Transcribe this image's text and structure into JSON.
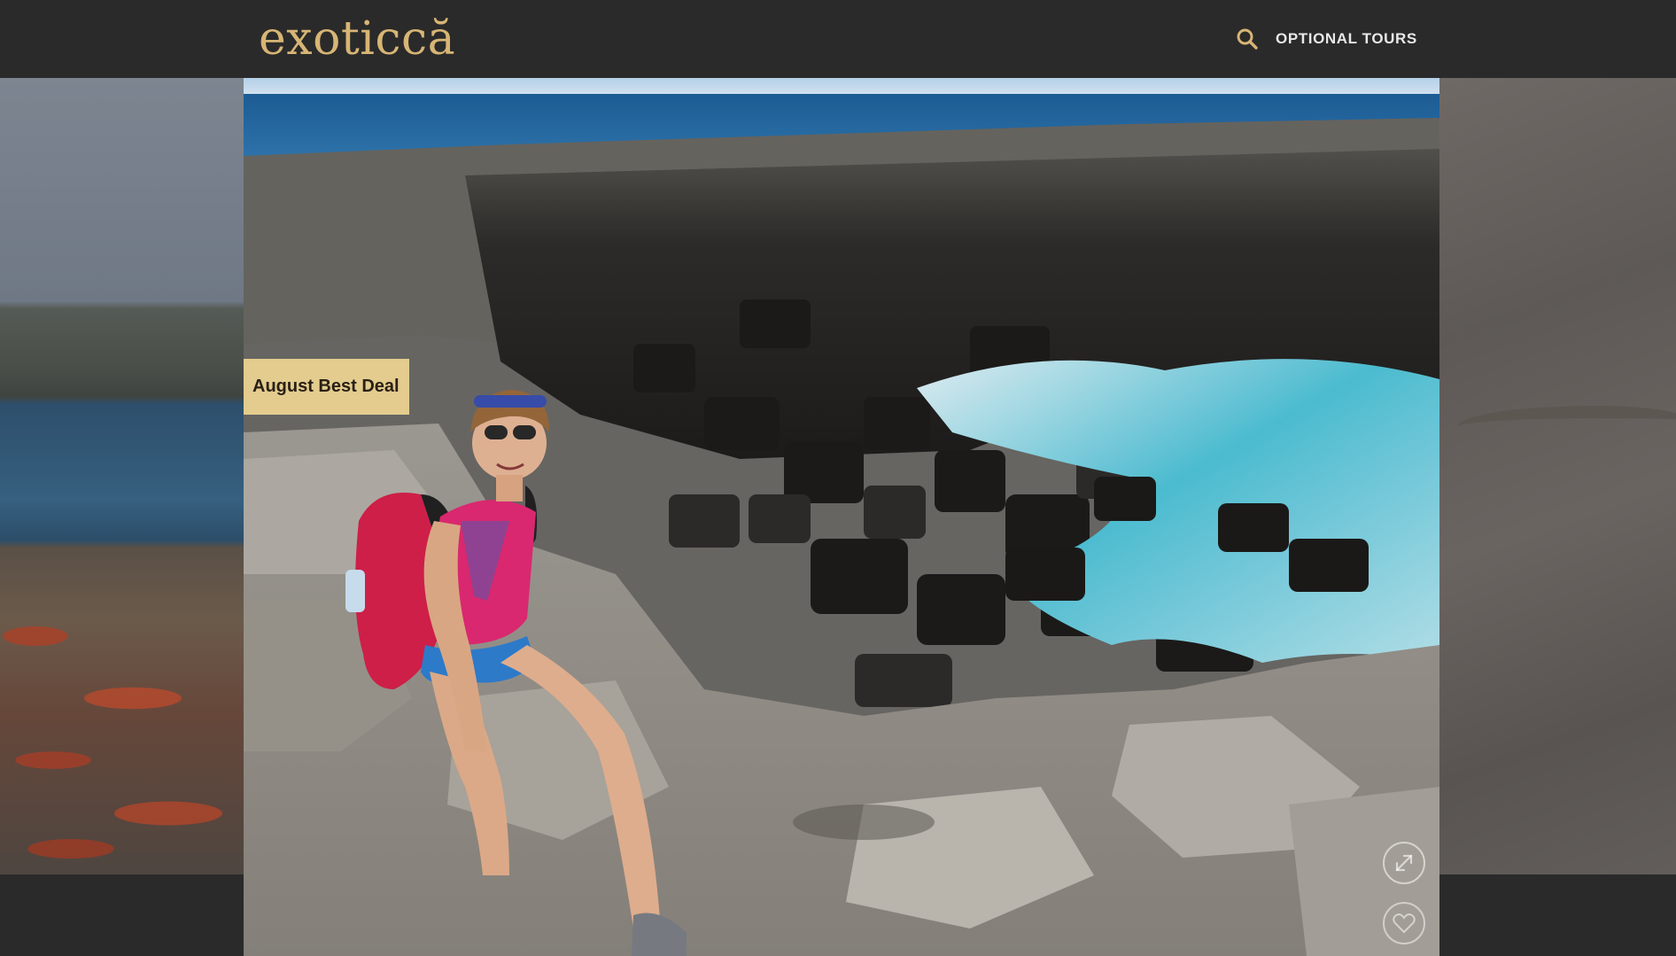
{
  "header": {
    "logo_text": "exoticcă",
    "search_icon": "search-icon",
    "nav_link": "OPTIONAL TOURS"
  },
  "slider": {
    "main_slide": {
      "badge": "August Best Deal",
      "expand_icon": "expand-icon",
      "secondary_icon": "heart-icon"
    }
  },
  "colors": {
    "header_bg": "#2a2a2a",
    "accent_gold": "#d7b575",
    "badge_bg": "#e3cc8e",
    "nav_text": "#e8e8e8"
  }
}
